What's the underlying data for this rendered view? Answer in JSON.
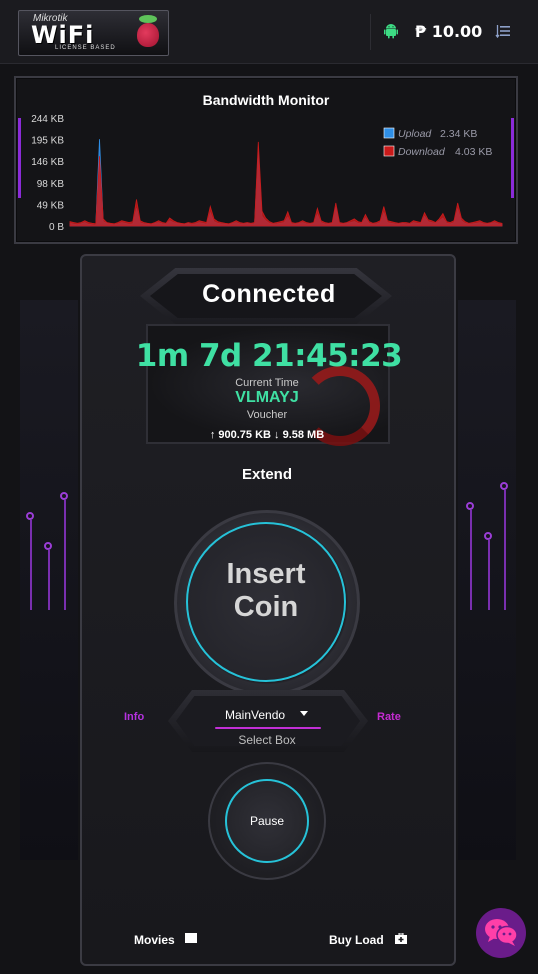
{
  "header": {
    "logo": {
      "top_text": "Mikrotik",
      "main_text": "WiFi",
      "sub_text": "LICENSE BASED"
    },
    "balance": "₱ 10.00",
    "icons": [
      "android-icon",
      "sort-menu-icon"
    ],
    "accent_color": "#3fe0a3"
  },
  "bandwidth": {
    "title": "Bandwidth Monitor",
    "legend": [
      {
        "label": "Upload",
        "value": "2.34 KB",
        "color": "#2f8fe6"
      },
      {
        "label": "Download",
        "value": "4.03 KB",
        "color": "#c91a1a"
      }
    ],
    "chart_data": {
      "type": "area",
      "title": "Bandwidth Monitor",
      "ylabel": "",
      "xlabel": "",
      "ylim": [
        0,
        244
      ],
      "y_ticks": [
        "244 KB",
        "195 KB",
        "146 KB",
        "98 KB",
        "49 KB",
        "0 B"
      ],
      "series": [
        {
          "name": "Upload",
          "values": [
            6,
            4,
            3,
            5,
            8,
            4,
            3,
            2,
            196,
            10,
            6,
            4,
            3,
            5,
            8,
            6,
            4,
            5,
            40,
            7,
            5,
            4,
            3,
            6,
            8,
            5,
            4,
            12,
            8,
            6,
            5,
            4,
            6,
            3,
            5,
            8,
            6,
            4,
            30,
            10,
            6,
            5,
            4,
            3,
            6,
            8,
            5,
            4,
            6,
            4,
            5,
            172,
            22,
            12,
            6,
            4,
            5,
            6,
            8,
            20,
            5,
            4,
            6,
            8,
            5,
            4,
            6,
            26,
            8,
            5,
            4,
            6,
            42,
            5,
            4,
            6,
            8,
            10,
            6,
            5,
            18,
            6,
            4,
            5,
            8,
            30,
            8,
            6,
            5,
            4,
            6,
            5,
            4,
            8,
            6,
            5,
            22,
            10,
            8,
            6,
            12,
            18,
            6,
            5,
            8,
            38,
            12,
            6,
            4,
            5,
            6,
            8,
            5,
            4,
            6,
            8,
            5,
            4
          ]
        },
        {
          "name": "Download",
          "values": [
            10,
            8,
            6,
            8,
            12,
            8,
            6,
            5,
            158,
            16,
            8,
            6,
            5,
            8,
            12,
            10,
            8,
            10,
            60,
            12,
            8,
            6,
            5,
            8,
            12,
            8,
            6,
            18,
            12,
            8,
            6,
            5,
            8,
            6,
            8,
            12,
            10,
            8,
            44,
            16,
            10,
            8,
            6,
            5,
            8,
            12,
            8,
            6,
            8,
            6,
            8,
            190,
            34,
            18,
            10,
            6,
            8,
            10,
            12,
            32,
            8,
            6,
            8,
            12,
            8,
            6,
            8,
            40,
            12,
            8,
            6,
            8,
            52,
            8,
            6,
            8,
            12,
            16,
            10,
            8,
            26,
            10,
            6,
            8,
            12,
            44,
            12,
            10,
            8,
            6,
            8,
            8,
            6,
            12,
            10,
            8,
            30,
            14,
            12,
            8,
            16,
            28,
            10,
            8,
            12,
            52,
            18,
            10,
            6,
            8,
            10,
            12,
            8,
            6,
            8,
            12,
            8,
            6
          ]
        }
      ],
      "grid": false,
      "legend_position": "top-right"
    }
  },
  "session": {
    "status": "Connected",
    "timer": "1m 7d 21:45:23",
    "current_time_label": "Current Time",
    "voucher_code": "VLMAYJ",
    "voucher_label": "Voucher",
    "traffic": "↑ 900.75 KB ↓ 9.58 MB"
  },
  "actions": {
    "extend_label": "Extend",
    "insert_coin_line1": "Insert",
    "insert_coin_line2": "Coin",
    "info_label": "Info",
    "rate_label": "Rate",
    "select_value": "MainVendo",
    "select_label": "Select Box",
    "pause_label": "Pause",
    "movies_label": "Movies",
    "buyload_label": "Buy Load"
  }
}
